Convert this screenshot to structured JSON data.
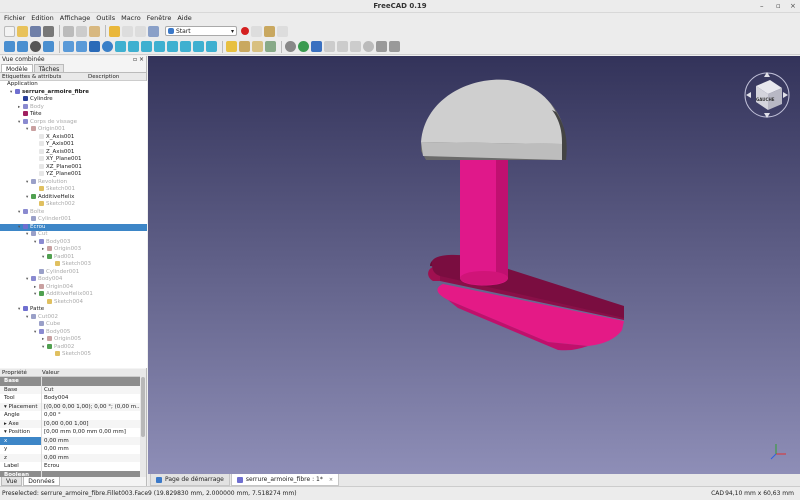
{
  "window": {
    "title": "FreeCAD 0.19"
  },
  "menu": [
    "Fichier",
    "Edition",
    "Affichage",
    "Outils",
    "Macro",
    "Fenêtre",
    "Aide"
  ],
  "workbench": {
    "selected": "Start"
  },
  "panel": {
    "title": "Vue combinée",
    "tabs": [
      "Modèle",
      "Tâches"
    ],
    "tree_header": [
      "Etiquettes & attributs",
      "Description"
    ],
    "bottom_tabs": [
      "Vue",
      "Données"
    ]
  },
  "tree": [
    {
      "depth": 0,
      "label": "Application",
      "style": "normal",
      "icon": ""
    },
    {
      "depth": 1,
      "label": "serrure_armoire_fibre",
      "style": "bold",
      "icon": "#6f6fd0",
      "tw": "▾"
    },
    {
      "depth": 2,
      "label": "Cylindre",
      "style": "normal",
      "icon": "#2a3f99"
    },
    {
      "depth": 2,
      "label": "Body",
      "style": "dim",
      "icon": "#8a8ad0",
      "tw": "▸"
    },
    {
      "depth": 2,
      "label": "Tête",
      "style": "normal",
      "icon": "#a02060"
    },
    {
      "depth": 2,
      "label": "Corps de vissage",
      "style": "dim",
      "icon": "#8a8ad0",
      "tw": "▾"
    },
    {
      "depth": 3,
      "label": "Origin001",
      "style": "dim",
      "icon": "#c9a0a0",
      "tw": "▾"
    },
    {
      "depth": 4,
      "label": "X_Axis001",
      "style": "normal",
      "icon": "#e7e7e7"
    },
    {
      "depth": 4,
      "label": "Y_Axis001",
      "style": "normal",
      "icon": "#e7e7e7"
    },
    {
      "depth": 4,
      "label": "Z_Axis001",
      "style": "normal",
      "icon": "#e7e7e7"
    },
    {
      "depth": 4,
      "label": "XY_Plane001",
      "style": "normal",
      "icon": "#e7e7e7"
    },
    {
      "depth": 4,
      "label": "XZ_Plane001",
      "style": "normal",
      "icon": "#e7e7e7"
    },
    {
      "depth": 4,
      "label": "YZ_Plane001",
      "style": "normal",
      "icon": "#e7e7e7"
    },
    {
      "depth": 3,
      "label": "Revolution",
      "style": "dim",
      "icon": "#9aa0c8",
      "tw": "▾"
    },
    {
      "depth": 4,
      "label": "Sketch001",
      "style": "dim",
      "icon": "#e0c060"
    },
    {
      "depth": 3,
      "label": "AdditiveHelix",
      "style": "normal",
      "icon": "#50a050",
      "tw": "▾"
    },
    {
      "depth": 4,
      "label": "Sketch002",
      "style": "dim",
      "icon": "#e0c060"
    },
    {
      "depth": 2,
      "label": "Boîte",
      "style": "dim",
      "icon": "#8a8ad0",
      "tw": "▾"
    },
    {
      "depth": 3,
      "label": "Cylinder001",
      "style": "dim",
      "icon": "#9aa0c8"
    },
    {
      "depth": 2,
      "label": "Ecrou",
      "style": "sel",
      "icon": "#6f6fd0",
      "tw": "▾"
    },
    {
      "depth": 3,
      "label": "Cut",
      "style": "dim",
      "icon": "#9aa0c8",
      "tw": "▾"
    },
    {
      "depth": 4,
      "label": "Body003",
      "style": "dim",
      "icon": "#8a8ad0",
      "tw": "▾"
    },
    {
      "depth": 5,
      "label": "Origin003",
      "style": "dim",
      "icon": "#c9a0a0",
      "tw": "▸"
    },
    {
      "depth": 5,
      "label": "Pad001",
      "style": "dim",
      "icon": "#50a050",
      "tw": "▾"
    },
    {
      "depth": 6,
      "label": "Sketch003",
      "style": "dim",
      "icon": "#e0c060"
    },
    {
      "depth": 4,
      "label": "Cylinder001",
      "style": "dim",
      "icon": "#9aa0c8"
    },
    {
      "depth": 3,
      "label": "Body004",
      "style": "dim",
      "icon": "#8a8ad0",
      "tw": "▾"
    },
    {
      "depth": 4,
      "label": "Origin004",
      "style": "dim",
      "icon": "#c9a0a0",
      "tw": "▸"
    },
    {
      "depth": 4,
      "label": "AdditiveHelix001",
      "style": "dim",
      "icon": "#50a050",
      "tw": "▾"
    },
    {
      "depth": 5,
      "label": "Sketch004",
      "style": "dim",
      "icon": "#e0c060"
    },
    {
      "depth": 2,
      "label": "Patte",
      "style": "normal",
      "icon": "#6f6fd0",
      "tw": "▾"
    },
    {
      "depth": 3,
      "label": "Cut002",
      "style": "dim",
      "icon": "#9aa0c8",
      "tw": "▾"
    },
    {
      "depth": 4,
      "label": "Cube",
      "style": "dim",
      "icon": "#9aa0c8"
    },
    {
      "depth": 4,
      "label": "Body005",
      "style": "dim",
      "icon": "#8a8ad0",
      "tw": "▾"
    },
    {
      "depth": 5,
      "label": "Origin005",
      "style": "dim",
      "icon": "#c9a0a0",
      "tw": "▸"
    },
    {
      "depth": 5,
      "label": "Pad002",
      "style": "dim",
      "icon": "#50a050",
      "tw": "▾"
    },
    {
      "depth": 6,
      "label": "Sketch005",
      "style": "dim",
      "icon": "#e0c060"
    }
  ],
  "properties": {
    "header": [
      "Propriété",
      "Valeur"
    ],
    "rows": [
      {
        "type": "group",
        "key": "Base",
        "value": ""
      },
      {
        "key": "Base",
        "value": "Cut"
      },
      {
        "key": "Tool",
        "value": "Body004"
      },
      {
        "key": "▾ Placement",
        "value": "[(0,00 0,00 1,00); 0,00 °; (0,00 m..."
      },
      {
        "key": "   Angle",
        "value": "0,00 °"
      },
      {
        "key": " ▸ Axe",
        "value": "[0,00 0,00 1,00]"
      },
      {
        "key": " ▾ Position",
        "value": "[0,00 mm  0,00 mm  0,00 mm]"
      },
      {
        "key": "      x",
        "value": "0,00 mm",
        "sel": true
      },
      {
        "key": "      y",
        "value": "0,00 mm"
      },
      {
        "key": "      z",
        "value": "0,00 mm"
      },
      {
        "key": "Label",
        "value": "Ecrou"
      },
      {
        "type": "group",
        "key": "Boolean",
        "value": ""
      }
    ]
  },
  "doc_tabs": [
    {
      "label": "Page de démarrage",
      "active": false
    },
    {
      "label": "serrure_armoire_fibre : 1*",
      "active": true
    }
  ],
  "status": {
    "message": "Preselected: serrure_armoire_fibre.Fillet003.Face9 (19.829830 mm, 2.000000 mm, 7.518274 mm)",
    "nav": "CAD",
    "dims": "94,10 mm x 60,63 mm"
  },
  "navcube": {
    "face": "GAUCHE"
  },
  "colors": {
    "accent": "#3d86c7",
    "part_magenta": "#e01884",
    "head_grey": "#d0d0d0"
  }
}
